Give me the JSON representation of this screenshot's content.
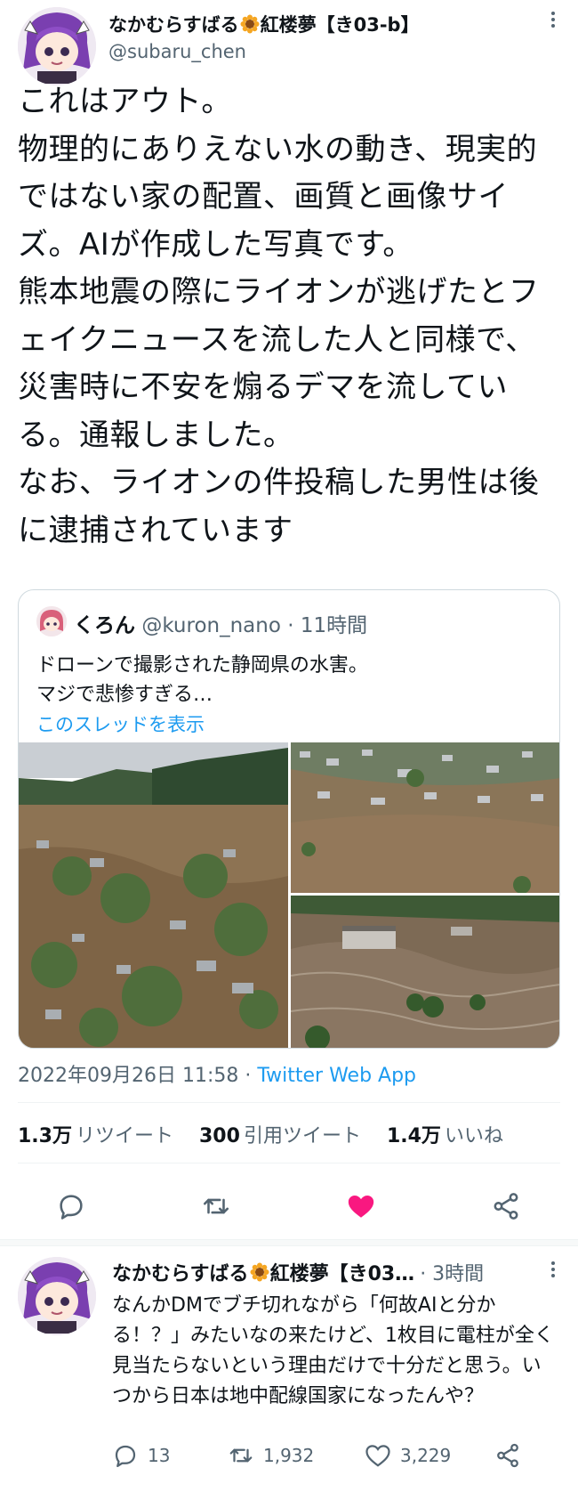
{
  "tweet": {
    "display_name": "なかむらすばる",
    "display_name_suffix": "紅楼夢【き03-b】",
    "handle": "@subaru_chen",
    "text": "これはアウト。\n物理的にありえない水の動き、現実的ではない家の配置、画質と画像サイズ。AIが作成した写真です。\n熊本地震の際にライオンが逃げたとフェイクニュースを流した人と同様で、災害時に不安を煽るデマを流している。通報しました。\nなお、ライオンの件投稿した男性は後に逮捕されています",
    "timestamp": "2022年09月26日 11:58",
    "separator": " · ",
    "client": "Twitter Web App",
    "stats": {
      "retweets_value": "1.3万",
      "retweets_label": "リツイート",
      "quotes_value": "300",
      "quotes_label": "引用ツイート",
      "likes_value": "1.4万",
      "likes_label": "いいね"
    }
  },
  "quoted": {
    "display_name": "くろん",
    "handle": "@kuron_nano",
    "time": "· 11時間",
    "text": "ドローンで撮影された静岡県の水害。\nマジで悲惨すぎる…",
    "show_thread": "このスレッドを表示"
  },
  "reply": {
    "display_name": "なかむらすばる",
    "display_name_suffix": "紅楼夢【き03…",
    "time": "· 3時間",
    "text": "なんかDMでブチ切れながら「何故AIと分かる！？」みたいなの来たけど、1枚目に電柱が全く見当たらないという理由だけで十分だと思う。いつから日本は地中配線国家になったんや？",
    "replies": "13",
    "retweets": "1,932",
    "likes": "3,229"
  },
  "colors": {
    "accent": "#1d9bf0",
    "like_active": "#f91880",
    "muted": "#536471"
  },
  "icons": [
    "more-icon",
    "reply-icon",
    "retweet-icon",
    "like-icon",
    "share-icon",
    "sunflower-icon"
  ]
}
